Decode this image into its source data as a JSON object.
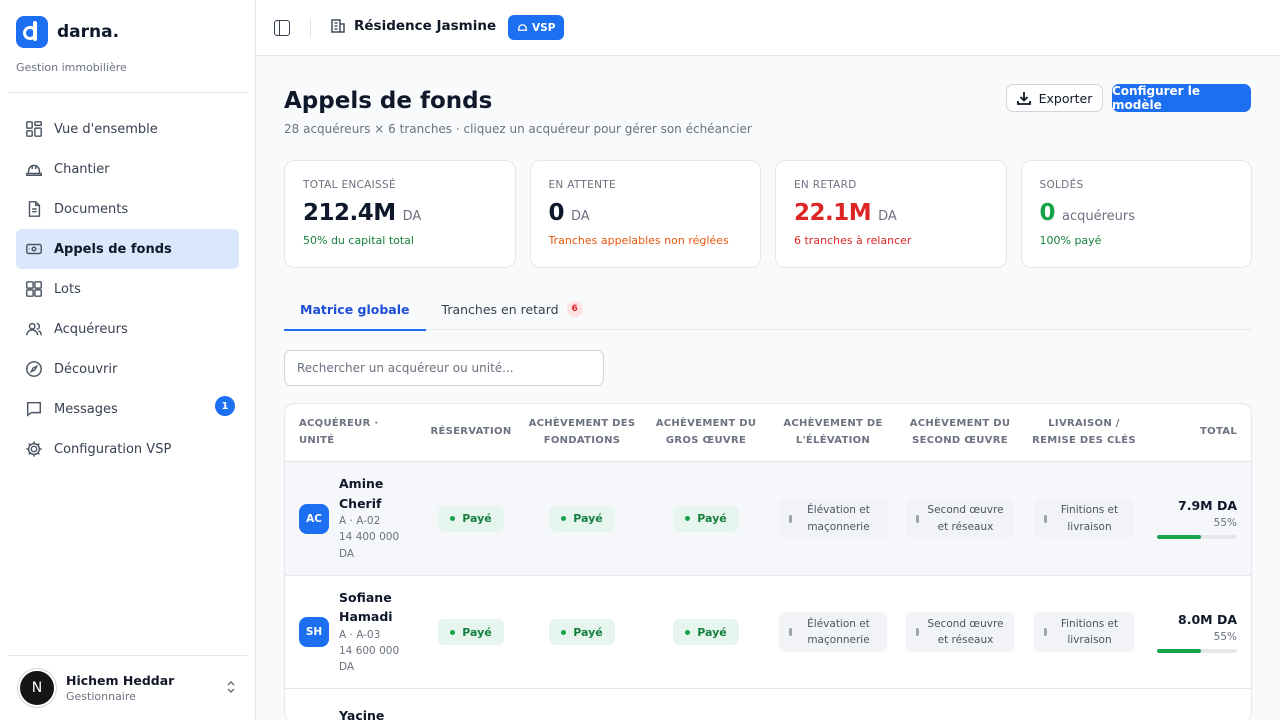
{
  "brand": {
    "name": "darna.",
    "subtitle": "Gestion immobilière"
  },
  "sidebar": {
    "items": [
      {
        "label": "Vue d'ensemble",
        "icon": "grid-icon"
      },
      {
        "label": "Chantier",
        "icon": "hard-hat-icon"
      },
      {
        "label": "Documents",
        "icon": "document-icon"
      },
      {
        "label": "Appels de fonds",
        "icon": "banknote-icon",
        "active": true
      },
      {
        "label": "Lots",
        "icon": "grid-icon"
      },
      {
        "label": "Acquéreurs",
        "icon": "users-icon"
      },
      {
        "label": "Découvrir",
        "icon": "compass-icon"
      },
      {
        "label": "Messages",
        "icon": "message-icon",
        "badge": "1"
      },
      {
        "label": "Configuration VSP",
        "icon": "gear-icon"
      }
    ]
  },
  "user": {
    "initial": "N",
    "name": "Hichem Heddar",
    "role": "Gestionnaire"
  },
  "topbar": {
    "project": "Résidence Jasmine",
    "badge": "VSP"
  },
  "page": {
    "title": "Appels de fonds",
    "subtitle": "28 acquéreurs × 6 tranches · cliquez un acquéreur pour gérer son échéancier",
    "export_label": "Exporter",
    "configure_label": "Configurer le modèle"
  },
  "kpis": [
    {
      "label": "TOTAL ENCAISSÉ",
      "value": "212.4M",
      "unit": "DA",
      "note": "50% du capital total",
      "value_color": "#0f172a",
      "note_color": "#15803d"
    },
    {
      "label": "EN ATTENTE",
      "value": "0",
      "unit": "DA",
      "note": "Tranches appelables non réglées",
      "value_color": "#0f172a",
      "note_color": "#ea580c"
    },
    {
      "label": "EN RETARD",
      "value": "22.1M",
      "unit": "DA",
      "note": "6 tranches à relancer",
      "value_color": "#dc2626",
      "note_color": "#dc2626"
    },
    {
      "label": "SOLDÉS",
      "value": "0",
      "unit": "acquéreurs",
      "note": "100% payé",
      "value_color": "#16a34a",
      "note_color": "#15803d"
    }
  ],
  "tabs": [
    {
      "label": "Matrice globale",
      "active": true
    },
    {
      "label": "Tranches en retard",
      "count": "6"
    }
  ],
  "search": {
    "placeholder": "Rechercher un acquéreur ou unité..."
  },
  "table": {
    "headers": [
      "ACQUÉREUR · UNITÉ",
      "RÉSERVATION",
      "ACHÈVEMENT DES FONDATIONS",
      "ACHÈVEMENT DU GROS ŒUVRE",
      "ACHÈVEMENT DE L'ÉLÉVATION",
      "ACHÈVEMENT DU SECOND ŒUVRE",
      "LIVRAISON / REMISE DES CLÉS",
      "TOTAL"
    ],
    "paid_label": "Payé",
    "pending_labels": [
      "Élévation et maçonnerie",
      "Second œuvre et réseaux",
      "Finitions et livraison"
    ],
    "rows": [
      {
        "initials": "AC",
        "name": "Amine Cherif",
        "unit": "A · A-02",
        "amount": "14 400 000 DA",
        "total": "7.9M DA",
        "pct": "55%",
        "progress": 0.55
      },
      {
        "initials": "SH",
        "name": "Sofiane Hamadi",
        "unit": "A · A-03",
        "amount": "14 600 000 DA",
        "total": "8.0M DA",
        "pct": "55%",
        "progress": 0.55
      },
      {
        "name": "Yacine"
      }
    ]
  },
  "colors": {
    "accent": "#1d6ff2",
    "paid": "#16a34a",
    "danger": "#dc2626",
    "warning": "#ea580c"
  }
}
